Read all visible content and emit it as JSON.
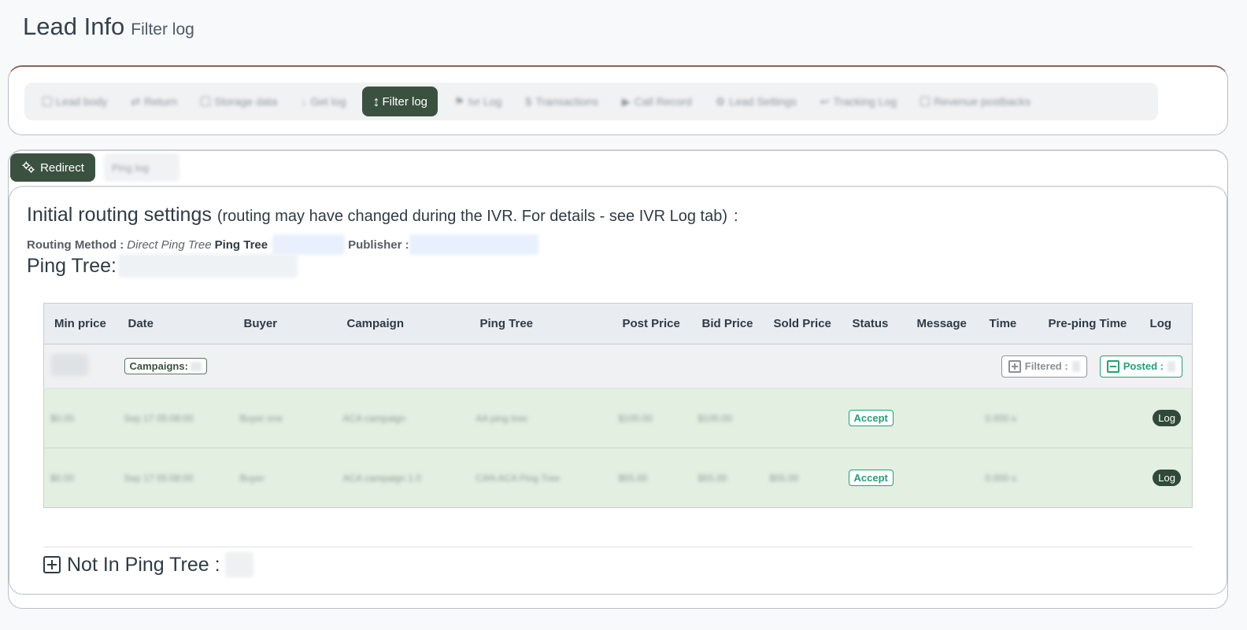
{
  "header": {
    "title": "Lead Info",
    "subtitle": "Filter log"
  },
  "tabs": [
    {
      "label": "Lead body",
      "active": false
    },
    {
      "label": "Return",
      "active": false
    },
    {
      "label": "Storage data",
      "active": false
    },
    {
      "label": "Get log",
      "active": false
    },
    {
      "label": "Filter log",
      "active": true
    },
    {
      "label": "Ivr Log",
      "active": false
    },
    {
      "label": "Transactions",
      "active": false
    },
    {
      "label": "Call Record",
      "active": false
    },
    {
      "label": "Lead Settings",
      "active": false
    },
    {
      "label": "Tracking Log",
      "active": false
    },
    {
      "label": "Revenue postbacks",
      "active": false
    }
  ],
  "subtabs": {
    "redirect_label": "Redirect",
    "second_label": "Ping log"
  },
  "routing": {
    "heading": "Initial routing settings",
    "note": "(routing may have changed during the IVR. For details - see IVR Log tab)",
    "colon": ":",
    "method_label": "Routing Method :",
    "method_value": "Direct Ping Tree",
    "ping_tree_label": "Ping Tree",
    "publisher_label": "Publisher :"
  },
  "ping_tree": {
    "title": "Ping Tree:"
  },
  "table": {
    "headers": [
      "Min price",
      "Date",
      "Buyer",
      "Campaign",
      "Ping Tree",
      "Post Price",
      "Bid Price",
      "Sold Price",
      "Status",
      "Message",
      "Time",
      "Pre-ping Time",
      "Log"
    ],
    "summary": {
      "campaigns_label": "Campaigns:",
      "filtered_label": "Filtered :",
      "posted_label": "Posted :"
    },
    "rows": [
      {
        "min_price": "$0.00",
        "date": "Sep 17 05:08:00",
        "buyer": "Buyer one",
        "campaign": "ACA campaign",
        "ping_tree": "AA ping tree",
        "post_price": "$100.00",
        "bid_price": "$100.00",
        "sold_price": "",
        "status": "Accept",
        "message": "",
        "time": "0.000 s",
        "pre_ping_time": "",
        "log": "Log"
      },
      {
        "min_price": "$0.00",
        "date": "Sep 17 05:08:00",
        "buyer": "Buyer",
        "campaign": "ACA campaign 1.0",
        "ping_tree": "CAN ACA Ping Tree",
        "post_price": "$55.00",
        "bid_price": "$55.00",
        "sold_price": "$55.00",
        "status": "Accept",
        "message": "",
        "time": "0.000 s",
        "pre_ping_time": "",
        "log": "Log"
      }
    ]
  },
  "not_in_tree": {
    "label": "Not In Ping Tree :"
  },
  "colors": {
    "accent_dark_green": "#3b5140",
    "accept_green": "#22a173",
    "row_green": "#e2efe1",
    "tab_card_top_border": "#8a6358"
  }
}
